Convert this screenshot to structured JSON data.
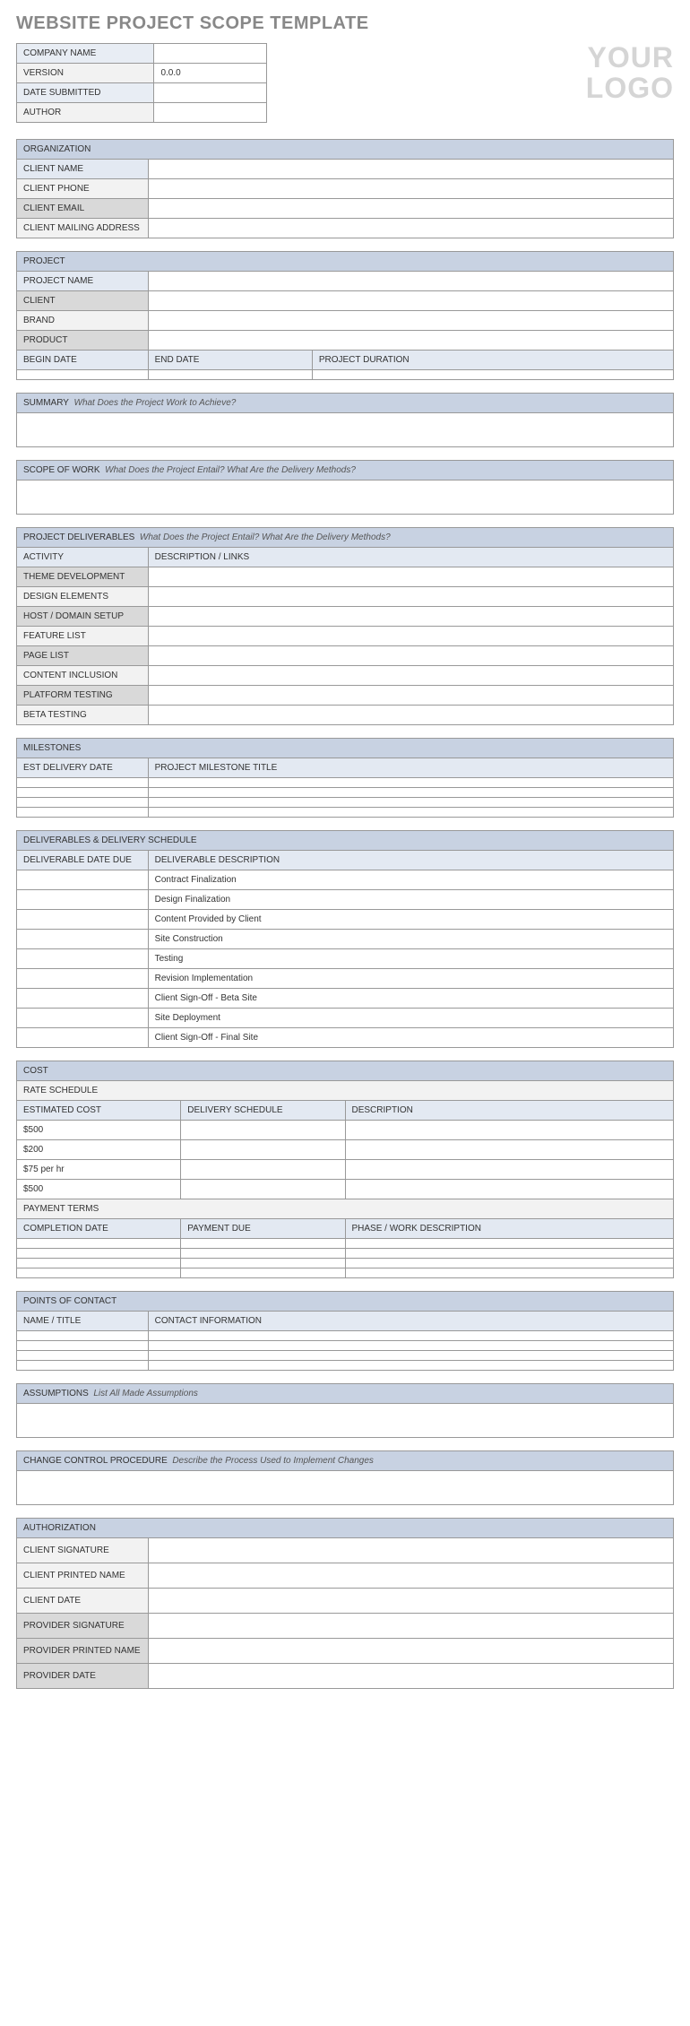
{
  "title": "WEBSITE PROJECT SCOPE TEMPLATE",
  "logo": "YOUR LOGO",
  "meta": {
    "company_name": {
      "label": "COMPANY NAME",
      "value": ""
    },
    "version": {
      "label": "VERSION",
      "value": "0.0.0"
    },
    "date_submitted": {
      "label": "DATE SUBMITTED",
      "value": ""
    },
    "author": {
      "label": "AUTHOR",
      "value": ""
    }
  },
  "organization": {
    "header": "ORGANIZATION",
    "client_name": "CLIENT NAME",
    "client_phone": "CLIENT  PHONE",
    "client_email": "CLIENT EMAIL",
    "client_mailing": "CLIENT MAILING ADDRESS"
  },
  "project": {
    "header": "PROJECT",
    "project_name": "PROJECT NAME",
    "client": "CLIENT",
    "brand": "BRAND",
    "product": "PRODUCT",
    "begin_date": "BEGIN DATE",
    "end_date": "END DATE",
    "duration": "PROJECT DURATION"
  },
  "summary": {
    "header": "SUMMARY",
    "hint": "What Does the Project Work to Achieve?"
  },
  "scope": {
    "header": "SCOPE OF WORK",
    "hint": "What Does the Project Entail? What Are the Delivery Methods?"
  },
  "deliverables": {
    "header": "PROJECT DELIVERABLES",
    "hint": "What Does the Project Entail? What Are the Delivery Methods?",
    "col_activity": "ACTIVITY",
    "col_desc": "DESCRIPTION / LINKS",
    "rows": [
      "THEME DEVELOPMENT",
      "DESIGN ELEMENTS",
      "HOST / DOMAIN SETUP",
      "FEATURE LIST",
      "PAGE LIST",
      "CONTENT INCLUSION",
      "PLATFORM TESTING",
      "BETA TESTING"
    ]
  },
  "milestones": {
    "header": "MILESTONES",
    "col_date": "EST DELIVERY DATE",
    "col_title": "PROJECT MILESTONE TITLE"
  },
  "schedule": {
    "header": "DELIVERABLES & DELIVERY SCHEDULE",
    "col_date": "DELIVERABLE DATE DUE",
    "col_desc": "DELIVERABLE DESCRIPTION",
    "rows": [
      "Contract Finalization",
      "Design Finalization",
      "Content Provided by Client",
      "Site Construction",
      "Testing",
      "Revision Implementation",
      "Client Sign-Off - Beta Site",
      "Site Deployment",
      "Client Sign-Off - Final Site"
    ]
  },
  "cost": {
    "header": "COST",
    "rate_schedule": "RATE SCHEDULE",
    "col_estimated": "ESTIMATED COST",
    "col_delivery": "DELIVERY SCHEDULE",
    "col_desc": "DESCRIPTION",
    "rates": [
      "$500",
      "$200",
      "$75 per hr",
      "$500"
    ],
    "payment_terms": "PAYMENT TERMS",
    "col_completion": "COMPLETION DATE",
    "col_payment_due": "PAYMENT DUE",
    "col_phase": "PHASE / WORK DESCRIPTION"
  },
  "contacts": {
    "header": "POINTS OF CONTACT",
    "col_name": "NAME / TITLE",
    "col_info": "CONTACT INFORMATION"
  },
  "assumptions": {
    "header": "ASSUMPTIONS",
    "hint": "List All Made Assumptions"
  },
  "change": {
    "header": "CHANGE CONTROL PROCEDURE",
    "hint": "Describe the Process Used to Implement Changes"
  },
  "authorization": {
    "header": "AUTHORIZATION",
    "client_sig": "CLIENT SIGNATURE",
    "client_name": "CLIENT PRINTED NAME",
    "client_date": "CLIENT DATE",
    "provider_sig": "PROVIDER SIGNATURE",
    "provider_name": "PROVIDER PRINTED NAME",
    "provider_date": "PROVIDER DATE"
  }
}
